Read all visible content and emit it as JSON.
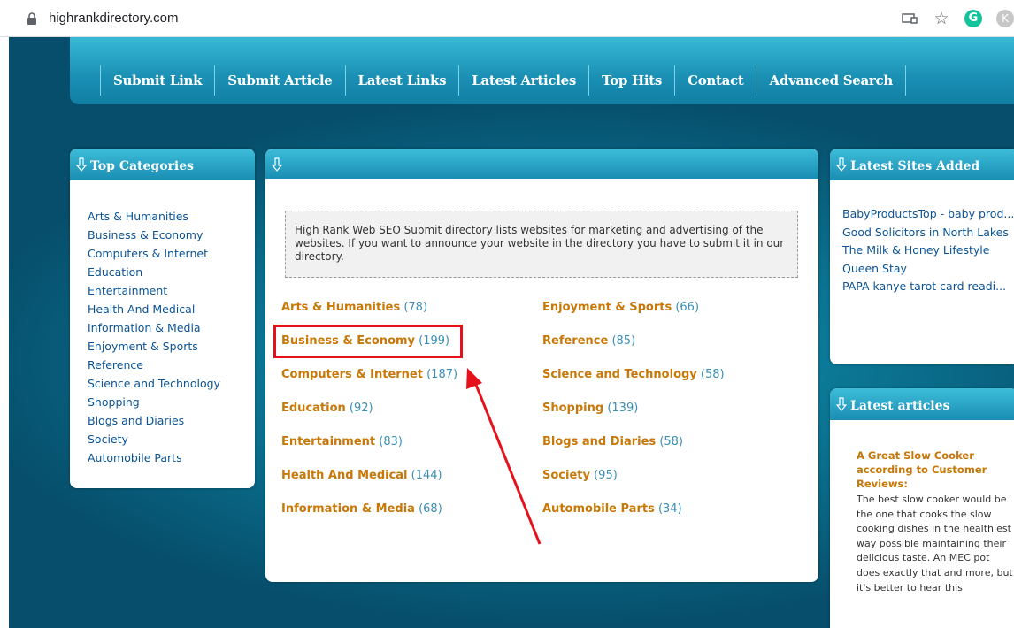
{
  "browser": {
    "url": "highrankdirectory.com",
    "icons": [
      "lock-icon",
      "cast-icon",
      "star-icon",
      "grammarly-icon",
      "profile-icon"
    ],
    "grammarly_letter": "G",
    "profile_letter": "K"
  },
  "nav": {
    "items": [
      "Submit Link",
      "Submit Article",
      "Latest Links",
      "Latest Articles",
      "Top Hits",
      "Contact",
      "Advanced Search"
    ]
  },
  "left_panel": {
    "title": "Top Categories",
    "items": [
      "Arts & Humanities",
      "Business & Economy",
      "Computers & Internet",
      "Education",
      "Entertainment",
      "Health And Medical",
      "Information & Media",
      "Enjoyment & Sports",
      "Reference",
      "Science and Technology",
      "Shopping",
      "Blogs and Diaries",
      "Society",
      "Automobile Parts"
    ]
  },
  "center_panel": {
    "intro": "High Rank Web SEO Submit directory lists websites for marketing and advertising of the websites. If you want to announce your website in the directory you have to submit it in our directory.",
    "categories_left": [
      {
        "name": "Arts & Humanities",
        "count": "(78)"
      },
      {
        "name": "Business & Economy",
        "count": "(199)"
      },
      {
        "name": "Computers & Internet",
        "count": "(187)"
      },
      {
        "name": "Education",
        "count": "(92)"
      },
      {
        "name": "Entertainment",
        "count": "(83)"
      },
      {
        "name": "Health And Medical",
        "count": "(144)"
      },
      {
        "name": "Information & Media",
        "count": "(68)"
      }
    ],
    "categories_right": [
      {
        "name": "Enjoyment & Sports",
        "count": "(66)"
      },
      {
        "name": "Reference",
        "count": "(85)"
      },
      {
        "name": "Science and Technology",
        "count": "(58)"
      },
      {
        "name": "Shopping",
        "count": "(139)"
      },
      {
        "name": "Blogs and Diaries",
        "count": "(58)"
      },
      {
        "name": "Society",
        "count": "(95)"
      },
      {
        "name": "Automobile Parts",
        "count": "(34)"
      }
    ]
  },
  "latest_sites": {
    "title": "Latest Sites Added",
    "items": [
      "BabyProductsTop - baby prod...",
      "Good Solicitors in North Lakes",
      "The Milk & Honey Lifestyle",
      "Queen Stay",
      "PAPA kanye tarot card readi..."
    ]
  },
  "latest_articles": {
    "title": "Latest articles",
    "article_title": "A Great Slow Cooker according to Customer Reviews:",
    "article_body": "The best slow cooker would be the one that cooks the slow cooking dishes in the healthiest way possible maintaining their delicious taste. An MEC pot does exactly that and more, but it's better to hear this"
  },
  "colors": {
    "link": "#0b5394",
    "category_name": "#c77808",
    "category_count": "#3b8fb5",
    "highlight": "#e5121b"
  }
}
